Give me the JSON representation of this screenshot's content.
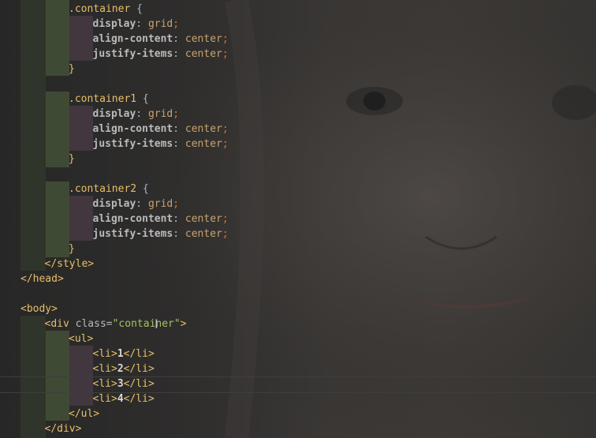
{
  "editor": {
    "lines": [
      {
        "tokens": [
          {
            "t": ".container",
            "c": "t-sel"
          },
          {
            "t": " {",
            "c": "t-plain"
          }
        ]
      },
      {
        "tokens": [
          {
            "t": "display",
            "c": "t-prop"
          },
          {
            "t": ": ",
            "c": "t-plain"
          },
          {
            "t": "grid",
            "c": "t-val"
          },
          {
            "t": ";",
            "c": "t-punc"
          }
        ]
      },
      {
        "tokens": [
          {
            "t": "align-content",
            "c": "t-prop"
          },
          {
            "t": ": ",
            "c": "t-plain"
          },
          {
            "t": "center",
            "c": "t-val"
          },
          {
            "t": ";",
            "c": "t-punc"
          }
        ]
      },
      {
        "tokens": [
          {
            "t": "justify-items",
            "c": "t-prop"
          },
          {
            "t": ": ",
            "c": "t-plain"
          },
          {
            "t": "center",
            "c": "t-val"
          },
          {
            "t": ";",
            "c": "t-punc"
          }
        ]
      },
      {
        "tokens": [
          {
            "t": "}",
            "c": "t-sel"
          }
        ]
      },
      {
        "tokens": []
      },
      {
        "tokens": [
          {
            "t": ".container1",
            "c": "t-sel"
          },
          {
            "t": " {",
            "c": "t-plain"
          }
        ]
      },
      {
        "tokens": [
          {
            "t": "display",
            "c": "t-prop"
          },
          {
            "t": ": ",
            "c": "t-plain"
          },
          {
            "t": "grid",
            "c": "t-val"
          },
          {
            "t": ";",
            "c": "t-punc"
          }
        ]
      },
      {
        "tokens": [
          {
            "t": "align-content",
            "c": "t-prop"
          },
          {
            "t": ": ",
            "c": "t-plain"
          },
          {
            "t": "center",
            "c": "t-val"
          },
          {
            "t": ";",
            "c": "t-punc"
          }
        ]
      },
      {
        "tokens": [
          {
            "t": "justify-items",
            "c": "t-prop"
          },
          {
            "t": ": ",
            "c": "t-plain"
          },
          {
            "t": "center",
            "c": "t-val"
          },
          {
            "t": ";",
            "c": "t-punc"
          }
        ]
      },
      {
        "tokens": [
          {
            "t": "}",
            "c": "t-sel"
          }
        ]
      },
      {
        "tokens": []
      },
      {
        "tokens": [
          {
            "t": ".container2",
            "c": "t-sel"
          },
          {
            "t": " {",
            "c": "t-plain"
          }
        ]
      },
      {
        "tokens": [
          {
            "t": "display",
            "c": "t-prop"
          },
          {
            "t": ": ",
            "c": "t-plain"
          },
          {
            "t": "grid",
            "c": "t-val"
          },
          {
            "t": ";",
            "c": "t-punc"
          }
        ]
      },
      {
        "tokens": [
          {
            "t": "align-content",
            "c": "t-prop"
          },
          {
            "t": ": ",
            "c": "t-plain"
          },
          {
            "t": "center",
            "c": "t-val"
          },
          {
            "t": ";",
            "c": "t-punc"
          }
        ]
      },
      {
        "tokens": [
          {
            "t": "justify-items",
            "c": "t-prop"
          },
          {
            "t": ": ",
            "c": "t-plain"
          },
          {
            "t": "center",
            "c": "t-val"
          },
          {
            "t": ";",
            "c": "t-punc"
          }
        ]
      },
      {
        "tokens": [
          {
            "t": "}",
            "c": "t-sel"
          }
        ]
      },
      {
        "tokens": [
          {
            "t": "</style>",
            "c": "t-tag"
          }
        ]
      },
      {
        "tokens": [
          {
            "t": "</head>",
            "c": "t-tag"
          }
        ]
      },
      {
        "tokens": []
      },
      {
        "tokens": [
          {
            "t": "<body>",
            "c": "t-tag"
          }
        ]
      },
      {
        "tokens": [
          {
            "t": "<div ",
            "c": "t-tag"
          },
          {
            "t": "class",
            "c": "t-attr"
          },
          {
            "t": "=",
            "c": "t-plain"
          },
          {
            "t": "\"container\"",
            "c": "t-str"
          },
          {
            "t": ">",
            "c": "t-tag"
          }
        ]
      },
      {
        "tokens": [
          {
            "t": "<ul>",
            "c": "t-tag"
          }
        ]
      },
      {
        "tokens": [
          {
            "t": "<li>",
            "c": "t-tag"
          },
          {
            "t": "1",
            "c": "t-text"
          },
          {
            "t": "</li>",
            "c": "t-tag"
          }
        ]
      },
      {
        "tokens": [
          {
            "t": "<li>",
            "c": "t-tag"
          },
          {
            "t": "2",
            "c": "t-text"
          },
          {
            "t": "</li>",
            "c": "t-tag"
          }
        ]
      },
      {
        "tokens": [
          {
            "t": "<li>",
            "c": "t-tag"
          },
          {
            "t": "3",
            "c": "t-text"
          },
          {
            "t": "</li>",
            "c": "t-tag"
          }
        ]
      },
      {
        "tokens": [
          {
            "t": "<li>",
            "c": "t-tag"
          },
          {
            "t": "4",
            "c": "t-text"
          },
          {
            "t": "</li>",
            "c": "t-tag"
          }
        ]
      },
      {
        "tokens": [
          {
            "t": "</ul>",
            "c": "t-tag"
          }
        ]
      },
      {
        "tokens": [
          {
            "t": "</div>",
            "c": "t-tag"
          }
        ]
      }
    ]
  },
  "colors": {
    "selector": "#e8bf6a",
    "property": "#bababa",
    "value": "#c9a26d",
    "punctuation": "#cc7832",
    "string": "#a5c25c",
    "indent_green": "#3f4a34",
    "indent_purple": "#42363f"
  },
  "icons": {
    "cursor": "i-beam-cursor"
  }
}
